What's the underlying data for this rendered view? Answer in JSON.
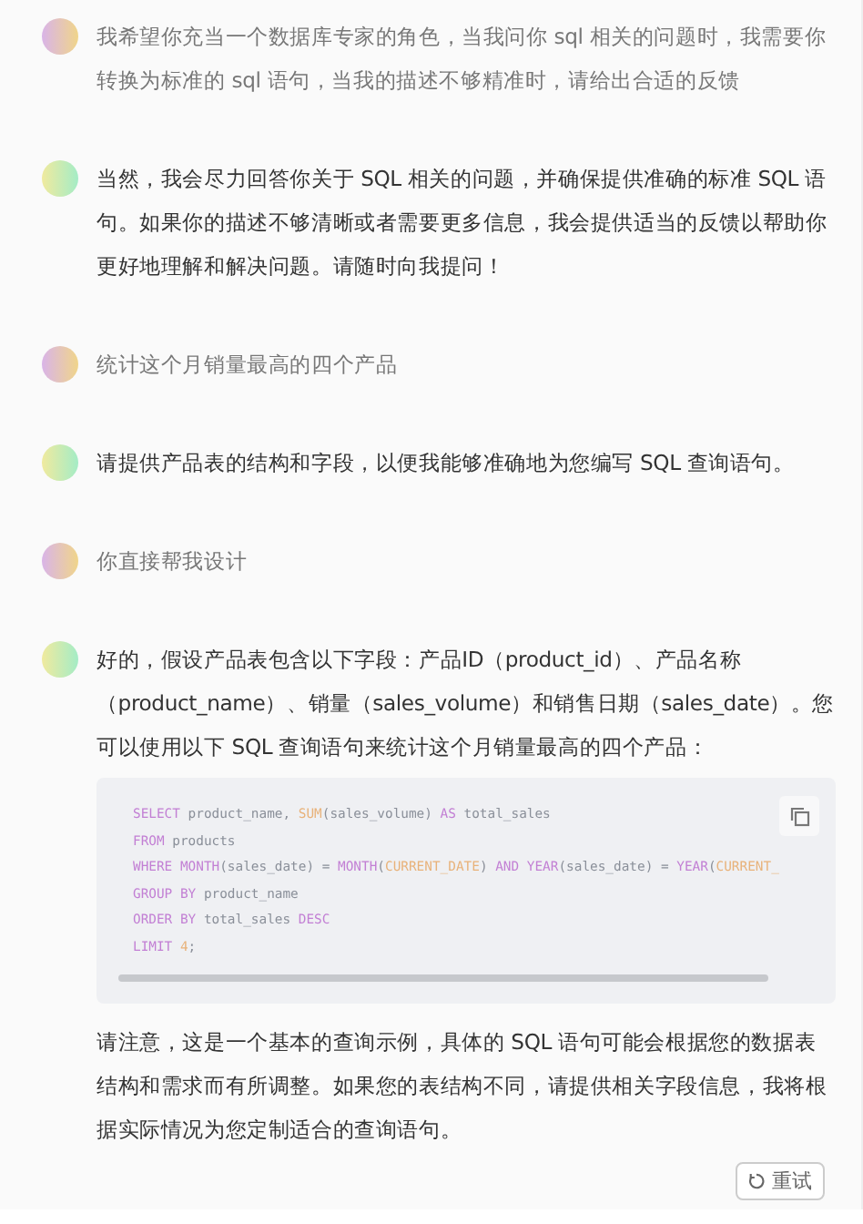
{
  "messages": [
    {
      "kind": "user",
      "blocks": [
        {
          "kind": "text",
          "text": "我希望你充当一个数据库专家的角色，当我问你 sql 相关的问题时，我需要你转换为标准的 sql 语句，当我的描述不够精准时，请给出合适的反馈"
        }
      ]
    },
    {
      "kind": "assistant",
      "blocks": [
        {
          "kind": "text",
          "text": "当然，我会尽力回答你关于 SQL 相关的问题，并确保提供准确的标准 SQL 语句。如果你的描述不够清晰或者需要更多信息，我会提供适当的反馈以帮助你更好地理解和解决问题。请随时向我提问！"
        }
      ]
    },
    {
      "kind": "user",
      "blocks": [
        {
          "kind": "text",
          "text": "统计这个月销量最高的四个产品"
        }
      ]
    },
    {
      "kind": "assistant",
      "blocks": [
        {
          "kind": "text",
          "text": "请提供产品表的结构和字段，以便我能够准确地为您编写 SQL 查询语句。"
        }
      ]
    },
    {
      "kind": "user",
      "blocks": [
        {
          "kind": "text",
          "text": "你直接帮我设计"
        }
      ]
    },
    {
      "kind": "assistant",
      "blocks": [
        {
          "kind": "text",
          "text": "好的，假设产品表包含以下字段：产品ID（product_id）、产品名称（product_name）、销量（sales_volume）和销售日期（sales_date）。您可以使用以下 SQL 查询语句来统计这个月销量最高的四个产品："
        },
        {
          "kind": "code",
          "lines": [
            [
              {
                "kind": "keyword",
                "s": "SELECT"
              },
              {
                "kind": "plain",
                "s": " product_name, "
              },
              {
                "kind": "func",
                "s": "SUM"
              },
              {
                "kind": "plain",
                "s": "(sales_volume) "
              },
              {
                "kind": "keyword",
                "s": "AS"
              },
              {
                "kind": "plain",
                "s": " total_sales"
              }
            ],
            [
              {
                "kind": "keyword",
                "s": "FROM"
              },
              {
                "kind": "plain",
                "s": " products"
              }
            ],
            [
              {
                "kind": "keyword",
                "s": "WHERE MONTH"
              },
              {
                "kind": "plain",
                "s": "(sales_date) = "
              },
              {
                "kind": "keyword",
                "s": "MONTH"
              },
              {
                "kind": "plain",
                "s": "("
              },
              {
                "kind": "func",
                "s": "CURRENT_DATE"
              },
              {
                "kind": "plain",
                "s": ") "
              },
              {
                "kind": "keyword",
                "s": "AND YEAR"
              },
              {
                "kind": "plain",
                "s": "(sales_date) = "
              },
              {
                "kind": "keyword",
                "s": "YEAR"
              },
              {
                "kind": "plain",
                "s": "("
              },
              {
                "kind": "func",
                "s": "CURRENT_"
              }
            ],
            [
              {
                "kind": "keyword",
                "s": "GROUP BY"
              },
              {
                "kind": "plain",
                "s": " product_name"
              }
            ],
            [
              {
                "kind": "keyword",
                "s": "ORDER BY"
              },
              {
                "kind": "plain",
                "s": " total_sales "
              },
              {
                "kind": "keyword",
                "s": "DESC"
              }
            ],
            [
              {
                "kind": "keyword",
                "s": "LIMIT "
              },
              {
                "kind": "func",
                "s": "4"
              },
              {
                "kind": "plain",
                "s": ";"
              }
            ]
          ]
        },
        {
          "kind": "text",
          "text": "请注意，这是一个基本的查询示例，具体的 SQL 语句可能会根据您的数据表结构和需求而有所调整。如果您的表结构不同，请提供相关字段信息，我将根据实际情况为您定制适合的查询语句。"
        }
      ]
    }
  ],
  "retry_button": {
    "label": "重试"
  }
}
